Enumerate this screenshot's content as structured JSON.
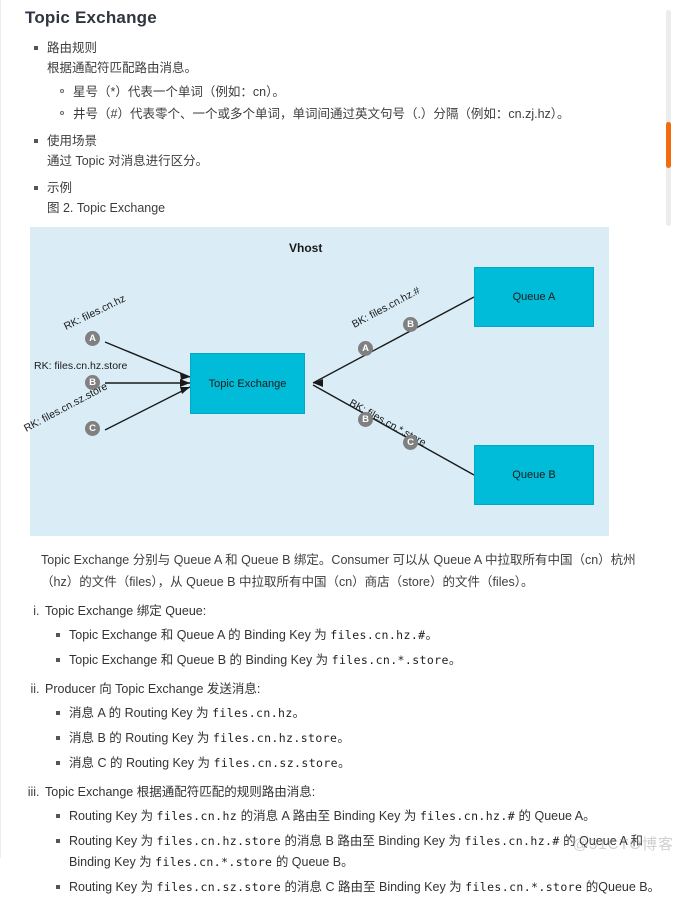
{
  "page_title": "Topic Exchange",
  "sections": [
    {
      "title": "路由规则",
      "body": "根据通配符匹配路由消息。",
      "sub_items": [
        "星号（*）代表一个单词（例如：cn）。",
        "井号（#）代表零个、一个或多个单词，单词间通过英文句号（.）分隔（例如：cn.zj.hz）。"
      ]
    },
    {
      "title": "使用场景",
      "body": "通过 Topic 对消息进行区分。",
      "sub_items": []
    },
    {
      "title": "示例",
      "body": "图 2. Topic Exchange",
      "sub_items": []
    }
  ],
  "diagram": {
    "vhost_label": "Vhost",
    "colors": {
      "background": "#daedf6",
      "node_fill": "#00bcd9",
      "marker_fill": "#808080",
      "line": "#1a1a1a"
    },
    "nodes": [
      {
        "id": "exchange",
        "label": "Topic Exchange"
      },
      {
        "id": "queue-a",
        "label": "Queue A"
      },
      {
        "id": "queue-b",
        "label": "Queue B"
      }
    ],
    "producer_edges": [
      {
        "marker": "A",
        "label": "RK: files.cn.hz"
      },
      {
        "marker": "B",
        "label": "RK: files.cn.hz.store"
      },
      {
        "marker": "C",
        "label": "RK: files.cn.sz.store"
      }
    ],
    "binding_edges": [
      {
        "label": "BK: files.cn.hz.#",
        "markers": [
          "A",
          "B"
        ]
      },
      {
        "label": "BK: files.cn.*.store",
        "markers": [
          "B",
          "C"
        ]
      }
    ]
  },
  "summary_paragraph": "Topic Exchange 分别与 Queue A 和 Queue B 绑定。Consumer 可以从 Queue A 中拉取所有中国（cn）杭州（hz）的文件（files），从 Queue B 中拉取所有中国（cn）商店（store）的文件（files）。",
  "steps": [
    {
      "heading": "Topic Exchange 绑定 Queue:",
      "items": [
        {
          "pre": "Topic Exchange 和 Queue A 的 Binding Key 为 ",
          "code": "files.cn.hz.#",
          "post": "。"
        },
        {
          "pre": "Topic Exchange 和 Queue B 的 Binding Key 为 ",
          "code": "files.cn.*.store",
          "post": "。"
        }
      ]
    },
    {
      "heading": "Producer 向 Topic Exchange 发送消息:",
      "items": [
        {
          "pre": "消息 A 的 Routing Key 为 ",
          "code": "files.cn.hz",
          "post": "。"
        },
        {
          "pre": "消息 B 的 Routing Key 为 ",
          "code": "files.cn.hz.store",
          "post": "。"
        },
        {
          "pre": "消息 C 的 Routing Key 为 ",
          "code": "files.cn.sz.store",
          "post": "。"
        }
      ]
    },
    {
      "heading": "Topic Exchange 根据通配符匹配的规则路由消息:",
      "items": [
        {
          "pre": "Routing Key 为 ",
          "code": "files.cn.hz",
          "mid": " 的消息 A 路由至 Binding Key 为 ",
          "code2": "files.cn.hz.#",
          "post": " 的 Queue A。"
        },
        {
          "pre": "Routing Key 为 ",
          "code": "files.cn.hz.store",
          "mid": " 的消息 B 路由至 Binding Key 为 ",
          "code2": "files.cn.hz.#",
          "post": " 的 Queue A 和 Binding Key 为 ",
          "code3": "files.cn.*.store",
          "post2": " 的 Queue B。"
        },
        {
          "pre": "Routing Key 为 ",
          "code": "files.cn.sz.store",
          "mid": " 的消息 C 路由至 Binding Key 为 ",
          "code2": "files.cn.*.store",
          "post": " 的Queue B。"
        }
      ]
    }
  ],
  "scrollbar": {
    "accent_color": "#f26c0d",
    "track_color": "#ececec"
  },
  "watermark": "@51CTO博客"
}
